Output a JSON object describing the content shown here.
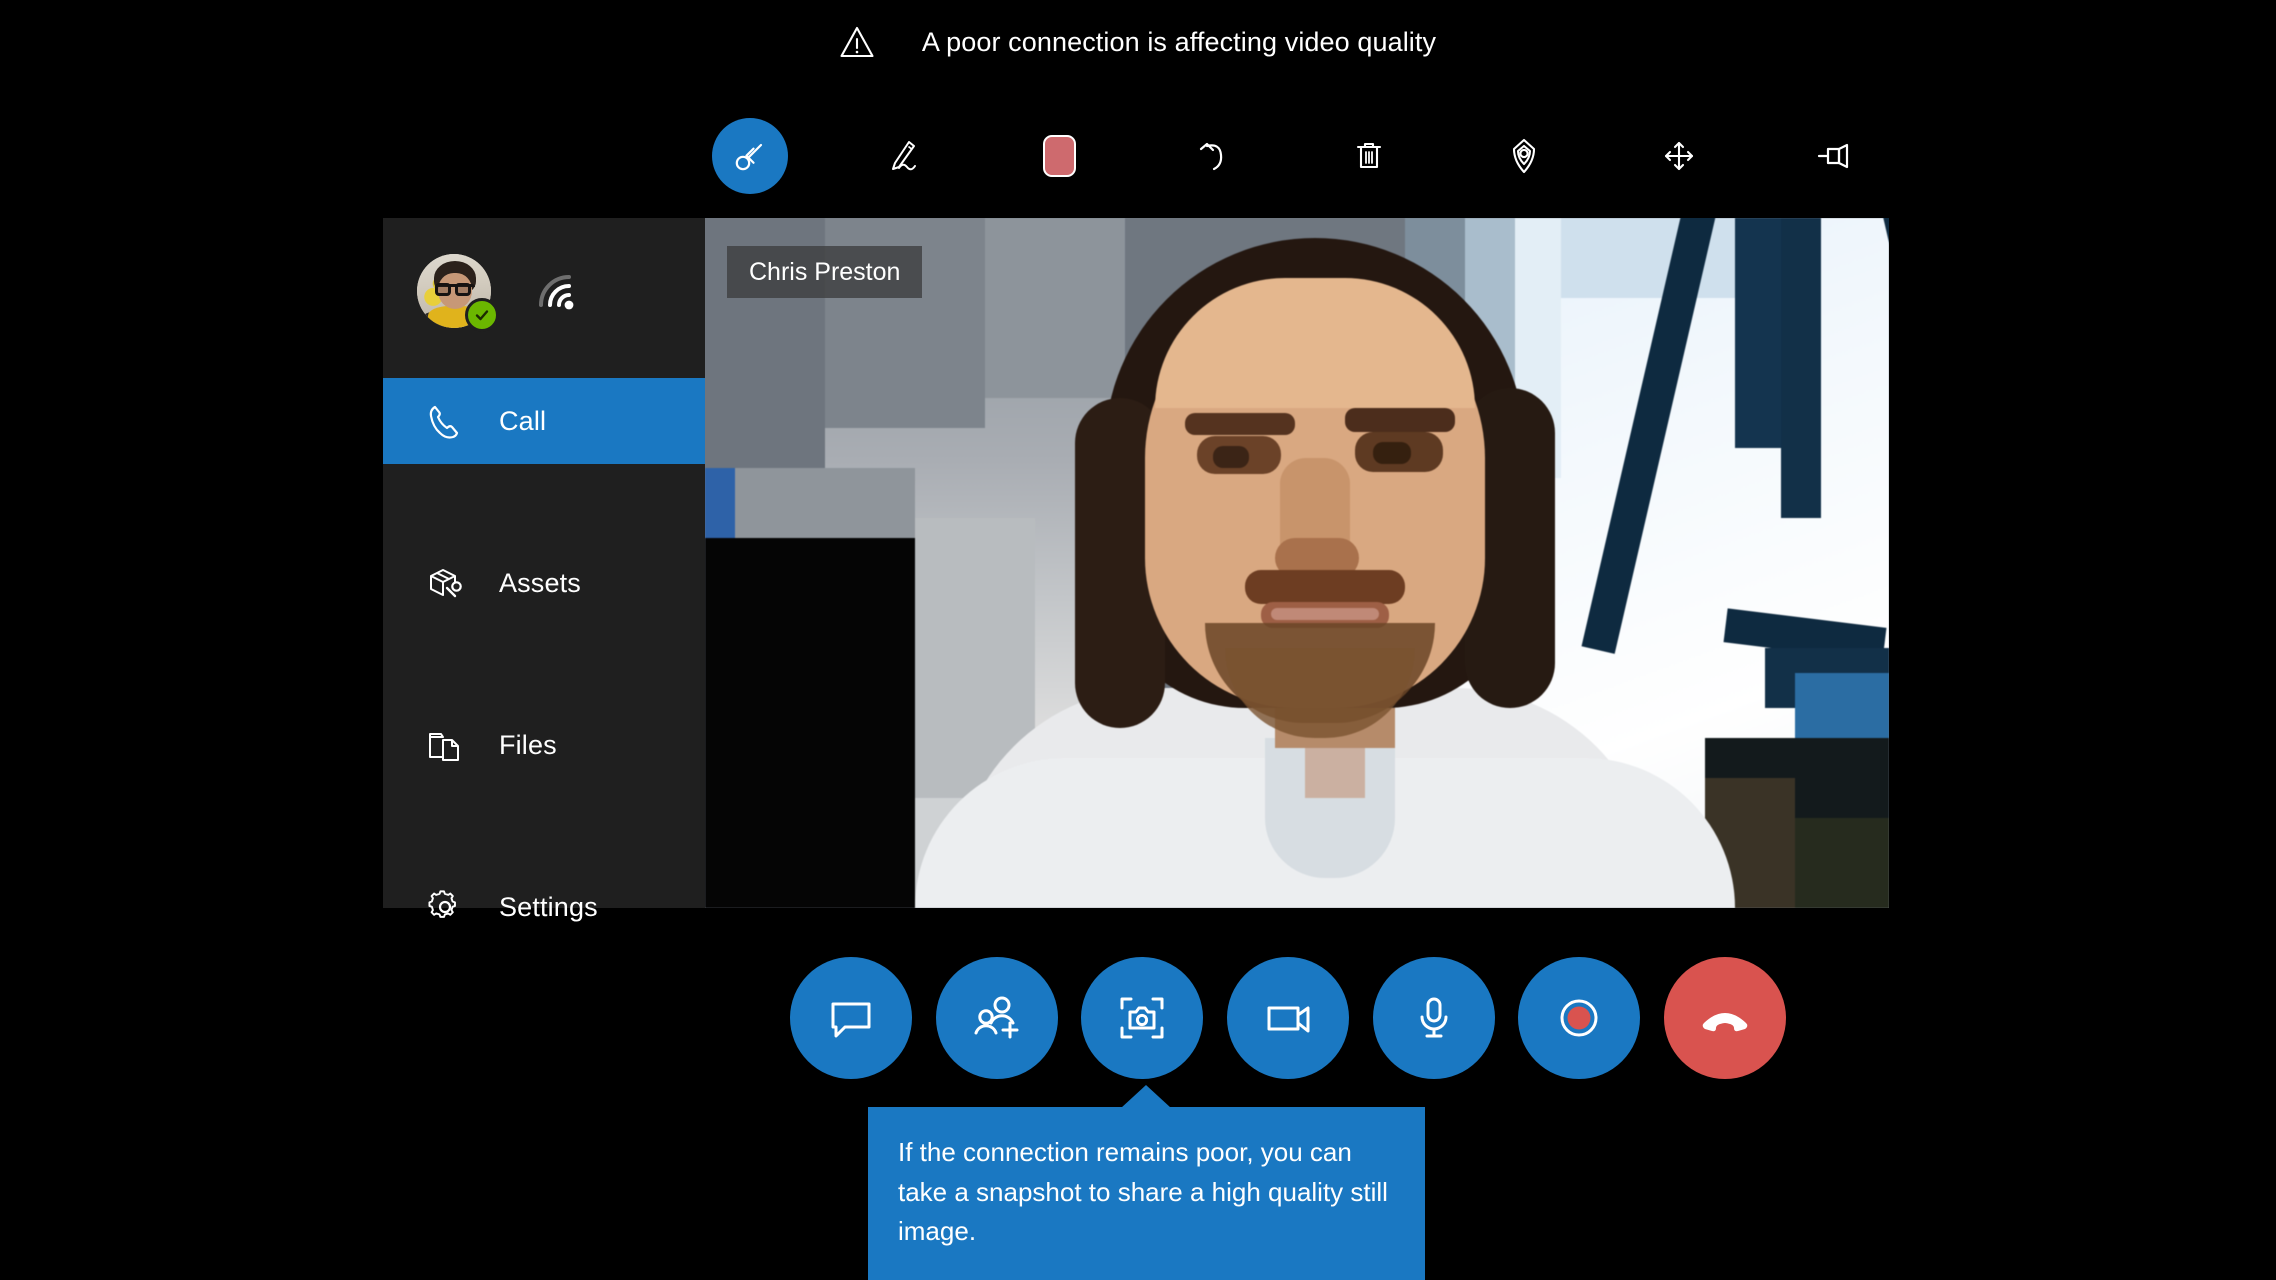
{
  "warning": {
    "icon": "warning-triangle-icon",
    "message": "A poor connection is affecting video quality"
  },
  "colors": {
    "accent_blue": "#1a78c2",
    "danger_red": "#d9534f",
    "swatch_red": "#ce6a6e",
    "status_green": "#6bb700",
    "sidebar_bg": "#1f1f1f",
    "page_bg": "#000000"
  },
  "toolbar": {
    "tools": [
      {
        "name": "select-tool",
        "icon": "arrow-into-circle-icon",
        "label": "Select",
        "active": true
      },
      {
        "name": "ink-tool",
        "icon": "pen-icon",
        "label": "Ink",
        "active": false
      },
      {
        "name": "color-tool",
        "icon": "color-swatch-icon",
        "label": "Color",
        "active": false,
        "color": "#ce6a6e"
      },
      {
        "name": "undo-tool",
        "icon": "undo-arrow-icon",
        "label": "Undo",
        "active": false
      },
      {
        "name": "delete-tool",
        "icon": "trash-icon",
        "label": "Delete all",
        "active": false
      },
      {
        "name": "arrow-tool",
        "icon": "location-pin-icon",
        "label": "Arrow",
        "active": false
      },
      {
        "name": "move-tool",
        "icon": "move-four-arrows-icon",
        "label": "Move",
        "active": false
      },
      {
        "name": "pin-tool",
        "icon": "pushpin-icon",
        "label": "Pin",
        "active": false
      }
    ]
  },
  "sidebar": {
    "profile": {
      "avatar": "user-avatar",
      "status": "available",
      "status_icon": "check-badge-icon",
      "signal_icon": "signal-strength-icon",
      "signal_bars_lit": 2,
      "signal_bars_total": 3
    },
    "items": [
      {
        "label": "Call",
        "icon": "phone-icon",
        "active": true
      },
      {
        "label": "Assets",
        "icon": "box-wrench-icon",
        "active": false
      },
      {
        "label": "Files",
        "icon": "folder-document-icon",
        "active": false
      },
      {
        "label": "Settings",
        "icon": "gear-icon",
        "active": false
      }
    ]
  },
  "video": {
    "participant_name": "Chris Preston",
    "quality": "low"
  },
  "call_controls": [
    {
      "name": "chat-button",
      "icon": "chat-bubble-icon",
      "label": "Chat",
      "style": "primary"
    },
    {
      "name": "add-people-button",
      "icon": "add-person-icon",
      "label": "Add people",
      "style": "primary"
    },
    {
      "name": "snapshot-button",
      "icon": "snapshot-camera-icon",
      "label": "Take snapshot",
      "style": "primary"
    },
    {
      "name": "video-button",
      "icon": "video-camera-icon",
      "label": "Video",
      "style": "primary"
    },
    {
      "name": "mute-button",
      "icon": "microphone-icon",
      "label": "Mute",
      "style": "primary"
    },
    {
      "name": "record-button",
      "icon": "record-dot-icon",
      "label": "Record",
      "style": "primary"
    },
    {
      "name": "end-call-button",
      "icon": "end-call-handset-icon",
      "label": "End call",
      "style": "danger"
    }
  ],
  "tooltip": {
    "text": "If the connection remains poor, you can take a snapshot to share a high quality still image.",
    "anchor": "snapshot-button"
  }
}
